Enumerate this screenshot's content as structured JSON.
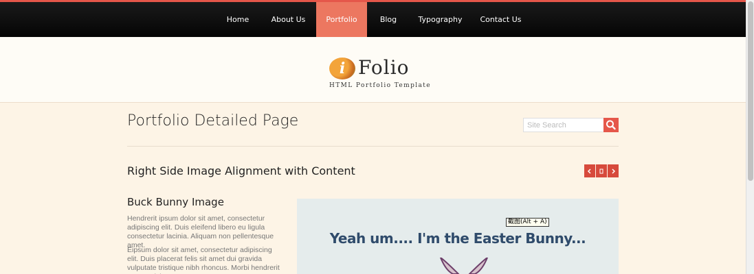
{
  "nav": {
    "items": [
      {
        "label": "Home"
      },
      {
        "label": "About Us"
      },
      {
        "label": "Portfolio"
      },
      {
        "label": "Blog"
      },
      {
        "label": "Typography"
      },
      {
        "label": "Contact Us"
      }
    ],
    "active": "Portfolio"
  },
  "logo": {
    "mark": "i",
    "wordmark": "Folio",
    "tagline": "HTML Portfolio Template"
  },
  "page": {
    "title": "Portfolio Detailed Page"
  },
  "search": {
    "placeholder": "Site Search",
    "icon": "search-icon"
  },
  "section": {
    "title": "Right Side Image Alignment with Content",
    "pager": {
      "prev_icon": "chevron-left-icon",
      "middle_icon": "grid-icon",
      "next_icon": "chevron-right-icon"
    }
  },
  "content": {
    "subtitle": "Buck Bunny Image",
    "paragraph1": "Hendrerit ipsum dolor sit amet, consectetur adipiscing elit. Duis eleifend libero eu ligula consectetur lacinia. Aliquam non pellentesque amet.",
    "paragraph2": "Eipsum dolor sit amet, consectetur adipiscing elit. Duis placerat felis sit amet dui gravida vulputate tristique nibh rhoncus. Morbi hendrerit cursus nisl"
  },
  "image": {
    "caption": "Yeah um.... I'm the Easter Bunny..."
  },
  "tooltip": {
    "text": "截图(Alt + A)"
  },
  "colors": {
    "accent": "#e5574a",
    "nav_bg": "#0a0a0a",
    "page_bg": "#fdf4e6",
    "text_heading": "#222222",
    "text_body": "#777777"
  }
}
